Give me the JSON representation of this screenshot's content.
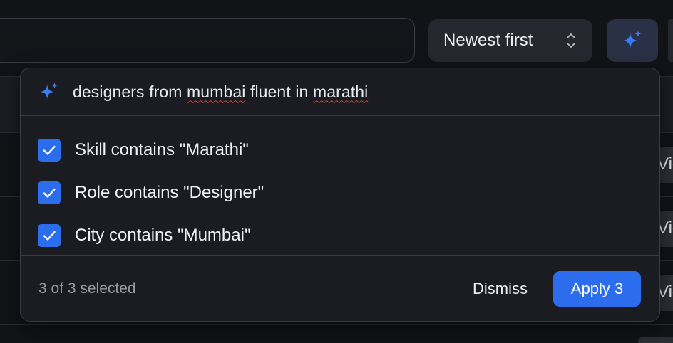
{
  "sort": {
    "label": "Newest first"
  },
  "table": {
    "view_label": "View"
  },
  "popover": {
    "query": "designers from mumbai fluent in marathi",
    "filters": [
      {
        "label": "Skill contains \"Marathi\"",
        "checked": true
      },
      {
        "label": "Role contains \"Designer\"",
        "checked": true
      },
      {
        "label": "City contains \"Mumbai\"",
        "checked": true
      }
    ],
    "selected_count": "3 of 3 selected",
    "dismiss_label": "Dismiss",
    "apply_label": "Apply 3"
  },
  "colors": {
    "accent": "#2b6dec",
    "background": "#121317",
    "popover": "#1b1c21"
  }
}
